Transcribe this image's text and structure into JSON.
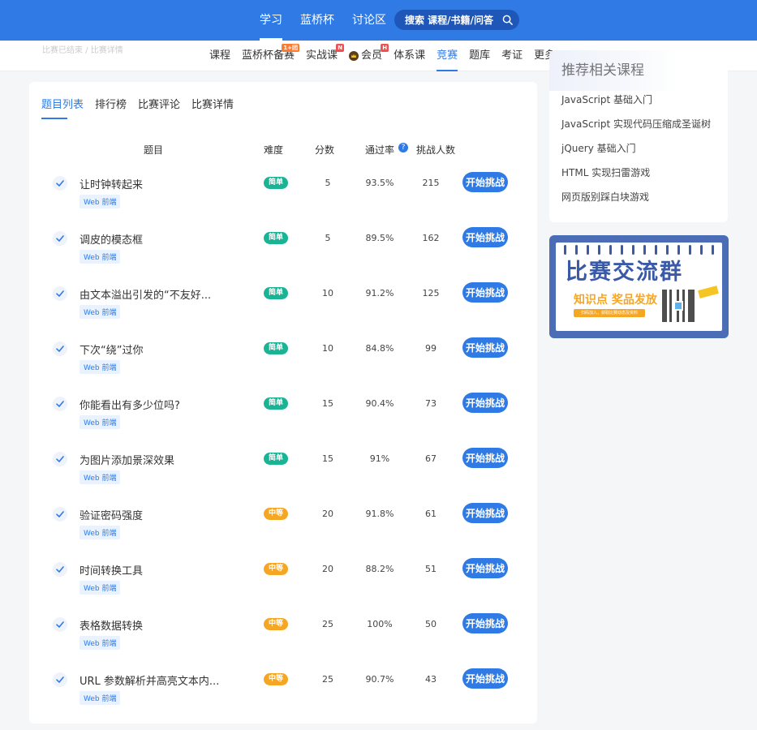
{
  "topnav": {
    "items": [
      {
        "label": "学习",
        "active": true
      },
      {
        "label": "蓝桥杯",
        "active": false
      },
      {
        "label": "讨论区",
        "active": false
      }
    ],
    "search_placeholder": "搜索 课程/书籍/问答"
  },
  "subnav": {
    "breadcrumb": "比赛已结束 / 比赛详情",
    "items": [
      {
        "label": "课程"
      },
      {
        "label": "蓝桥杯备赛",
        "badge": "1+团"
      },
      {
        "label": "实战课",
        "badge": "N"
      },
      {
        "label": "会员",
        "badge": "H"
      },
      {
        "label": "体系课"
      },
      {
        "label": "竞赛",
        "active": true
      },
      {
        "label": "题库"
      },
      {
        "label": "考证"
      },
      {
        "label": "更多"
      }
    ]
  },
  "tabs": [
    {
      "label": "题目列表",
      "active": true
    },
    {
      "label": "排行榜"
    },
    {
      "label": "比赛评论"
    },
    {
      "label": "比赛详情"
    }
  ],
  "table": {
    "headers": {
      "title": "题目",
      "difficulty": "难度",
      "score": "分数",
      "pass_rate": "通过率",
      "help": "?",
      "challengers": "挑战人数"
    },
    "button_label": "开始挑战",
    "colors": {
      "easy": "#1ab394",
      "medium": "#f5a623"
    },
    "rows": [
      {
        "title": "让时钟转起来",
        "tag": "Web 前端",
        "difficulty": "简单",
        "level": "easy",
        "score": "5",
        "pass_rate": "93.5%",
        "challengers": "215"
      },
      {
        "title": "调皮的模态框",
        "tag": "Web 前端",
        "difficulty": "简单",
        "level": "easy",
        "score": "5",
        "pass_rate": "89.5%",
        "challengers": "162"
      },
      {
        "title": "由文本溢出引发的“不友好...",
        "tag": "Web 前端",
        "difficulty": "简单",
        "level": "easy",
        "score": "10",
        "pass_rate": "91.2%",
        "challengers": "125"
      },
      {
        "title": "下次“绕”过你",
        "tag": "Web 前端",
        "difficulty": "简单",
        "level": "easy",
        "score": "10",
        "pass_rate": "84.8%",
        "challengers": "99"
      },
      {
        "title": "你能看出有多少位吗?",
        "tag": "Web 前端",
        "difficulty": "简单",
        "level": "easy",
        "score": "15",
        "pass_rate": "90.4%",
        "challengers": "73"
      },
      {
        "title": "为图片添加景深效果",
        "tag": "Web 前端",
        "difficulty": "简单",
        "level": "easy",
        "score": "15",
        "pass_rate": "91%",
        "challengers": "67"
      },
      {
        "title": "验证密码强度",
        "tag": "Web 前端",
        "difficulty": "中等",
        "level": "medium",
        "score": "20",
        "pass_rate": "91.8%",
        "challengers": "61"
      },
      {
        "title": "时间转换工具",
        "tag": "Web 前端",
        "difficulty": "中等",
        "level": "medium",
        "score": "20",
        "pass_rate": "88.2%",
        "challengers": "51"
      },
      {
        "title": "表格数据转换",
        "tag": "Web 前端",
        "difficulty": "中等",
        "level": "medium",
        "score": "25",
        "pass_rate": "100%",
        "challengers": "50"
      },
      {
        "title": "URL 参数解析并高亮文本内...",
        "tag": "Web 前端",
        "difficulty": "中等",
        "level": "medium",
        "score": "25",
        "pass_rate": "90.7%",
        "challengers": "43"
      }
    ]
  },
  "recommend": {
    "title": "推荐相关课程",
    "items": [
      "JavaScript 基础入门",
      "JavaScript 实现代码压缩成圣诞树",
      "jQuery 基础入门",
      "HTML 实现扫雷游戏",
      "网页版别踩白块游戏"
    ]
  },
  "banner": {
    "title": "比赛交流群",
    "subtitle": "知识点  奖品发放",
    "strip": "扫码加入，获取比赛动态及资料",
    "colors": {
      "frame": "#4a6db5",
      "accent": "#f5a623"
    }
  }
}
